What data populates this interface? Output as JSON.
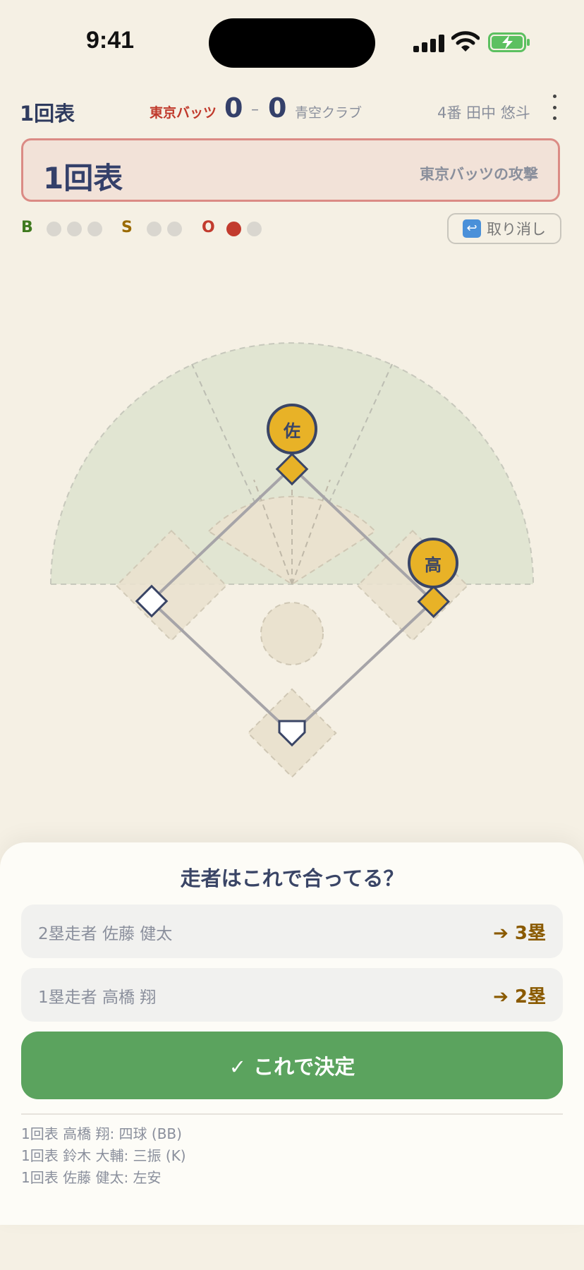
{
  "status_bar": {
    "time": "9:41"
  },
  "header": {
    "inning": "1回表",
    "away_team": "東京バッツ",
    "away_score": "0",
    "score_separator": "–",
    "home_score": "0",
    "home_team": "青空クラブ",
    "batter": "4番 田中 悠斗"
  },
  "banner": {
    "title": "1回表",
    "subtitle": "東京バッツの攻撃"
  },
  "count": {
    "balls_label": "B",
    "strikes_label": "S",
    "outs_label": "O",
    "balls": 0,
    "strikes": 0,
    "outs": 1,
    "max_balls": 3,
    "max_strikes": 2,
    "max_outs": 2
  },
  "undo": {
    "label": "取り消し",
    "icon": "undo-arrow-icon"
  },
  "field": {
    "runners": [
      {
        "base": "2塁",
        "marker": "佐"
      },
      {
        "base": "1塁",
        "marker": "高"
      }
    ]
  },
  "sheet": {
    "title": "走者はこれで合ってる？",
    "runners": [
      {
        "label": "2塁走者 佐藤 健太",
        "dest": "➔ 3塁"
      },
      {
        "label": "1塁走者 高橋 翔",
        "dest": "➔ 2塁"
      }
    ],
    "confirm_label": "✓ これで決定",
    "log": [
      "1回表 高橋 翔: 四球 (BB)",
      "1回表 鈴木 大輔: 三振 (K)",
      "1回表 佐藤 健太: 左安"
    ]
  },
  "colors": {
    "accent": "#5ba35e",
    "away_team": "#c0392b",
    "runner": "#e8b227",
    "out_dot": "#c23b2e",
    "ball_label": "#3f7a1f",
    "strike_label": "#9a6a00",
    "out_label": "#c23b2e"
  }
}
